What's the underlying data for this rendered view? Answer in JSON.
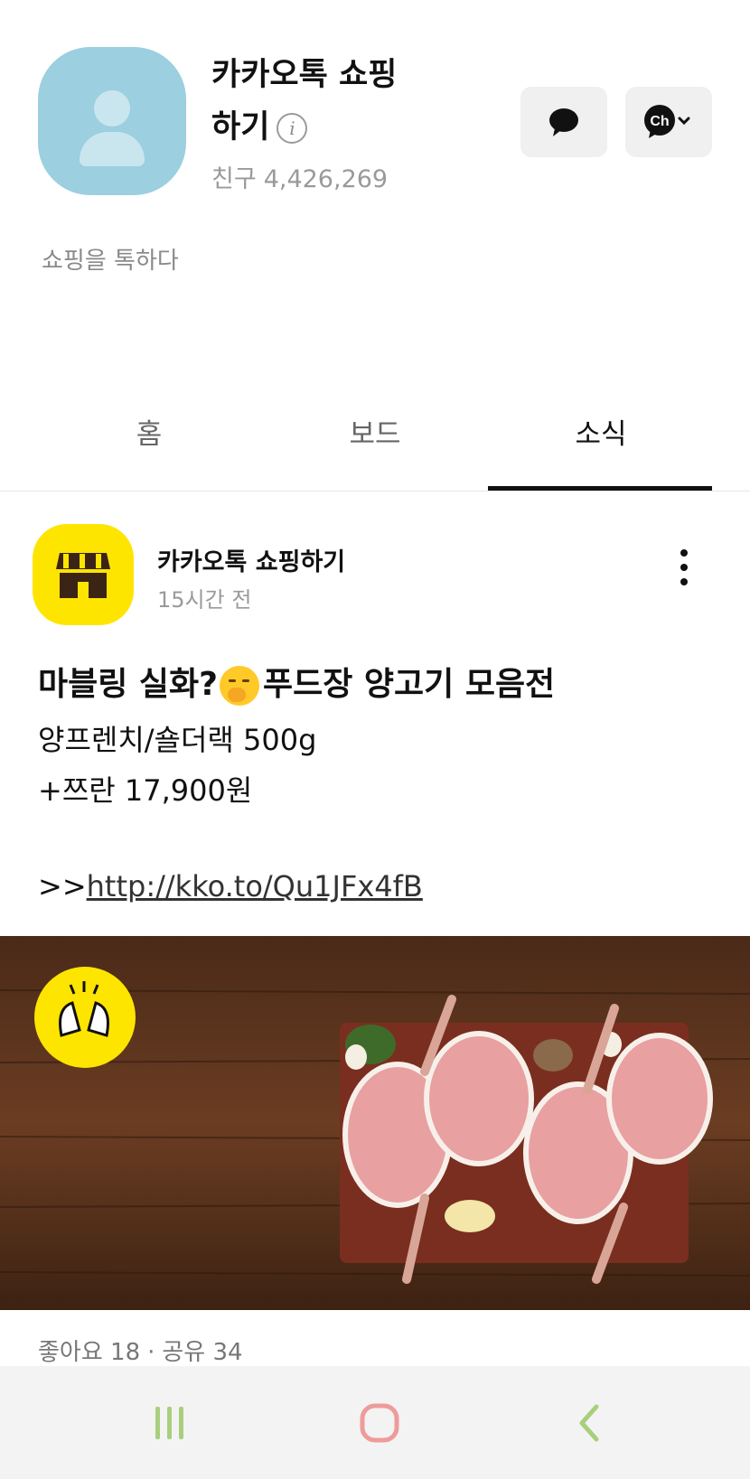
{
  "profile": {
    "name": "카카오톡 쇼핑하기",
    "friends_label": "친구",
    "friends_count": "4,426,269",
    "description": "쇼핑을 톡하다"
  },
  "tabs": [
    {
      "label": "홈",
      "active": false
    },
    {
      "label": "보드",
      "active": false
    },
    {
      "label": "소식",
      "active": true
    }
  ],
  "post": {
    "author": "카카오톡 쇼핑하기",
    "time": "15시간 전",
    "title_before_emoji": "마블링 실화?",
    "title_after_emoji": "푸드장 양고기 모음전",
    "line1": "양프렌치/숄더랙 500g",
    "line2": "+쯔란 17,900원",
    "link_prefix": ">>",
    "link": "http://kko.to/Qu1JFx4fB",
    "likes_label": "좋아요 18",
    "dot": "·",
    "shares_label": "공유 34"
  },
  "icons": {
    "chat": "chat-bubble-icon",
    "channel": "channel-icon",
    "info": "info-icon",
    "more": "more-vertical-icon",
    "shop": "shop-store-icon",
    "badge": "clapping-hands-icon"
  },
  "colors": {
    "avatar_bg": "#9ccfe0",
    "kakao_yellow": "#fee500",
    "nav_green": "#a8cf7c",
    "nav_red": "#ef9b9b"
  }
}
